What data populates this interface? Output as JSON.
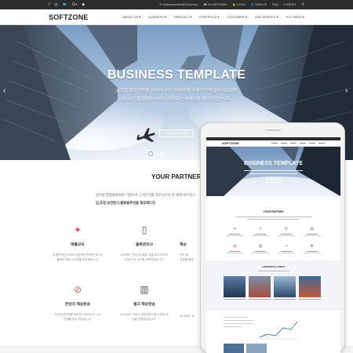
{
  "topbar": {
    "socials": [
      "f",
      "◎",
      "🐦",
      "G+",
      "▶"
    ],
    "email": "✉ Softzonecenter@Gmail.com",
    "phone": "☎ 010-5879-5899",
    "login": "🔒 LOGIN",
    "signup": "👤 SIGN UP",
    "faq": "FAQ",
    "language": "▾ 다중언어",
    "search_icon": "search-icon"
  },
  "header": {
    "logo": "SOFTZONE",
    "nav": [
      "ABOUT US ▾",
      "BUSINESS ▾",
      "PRODUCT ▾",
      "PORTFOLIO ▾",
      "CUSTOMER ▾",
      "GNU SERVICE ▾",
      "ETC MENU ▾"
    ]
  },
  "hero": {
    "title": "BUSINESS TEMPLATE",
    "line1": "글로벌 물류혁명을 위해서 가장 규제혁에, 국제가구역 물류기준설명",
    "line2": "OCC인 통합물류 서비스 경영하는 서비스을 제공하겠습니다.",
    "button": "VIEW PARTNERS",
    "prev": "‹",
    "next": "›"
  },
  "partner": {
    "title": "YOUR PARTNER",
    "line1": "글로벌 통합물류회원 기업으로 고객가치를 최우선으로 한 세계 네트워크",
    "line2": "입,포장,보관등의 물류솔루션을 제공해드리"
  },
  "features": [
    {
      "icon": "magic-wand-icon",
      "glyph": "✦",
      "title": "매출규모",
      "desc1": "우중력 예산 100% 성장하여 판매는 매 1조",
      "desc2": "플레이 목표가 성과를 달성했습니다."
    },
    {
      "icon": "smartphone-icon",
      "glyph": "▯",
      "title": "물류관리사",
      "desc1": "200명의 관리사로 물류 유통 분석 최고의",
      "desc2": "전망인 이 시스템 구축하였습니다."
    },
    {
      "icon": "link-icon",
      "glyph": "⊘",
      "title": "완성차 해상운송",
      "desc1": "안전한 운영계통 확보한 자동차사는 100",
      "desc2": "안재를 운송 하였습니다."
    },
    {
      "icon": "bar-chart-icon",
      "glyph": "▥",
      "title": "벌크 해상운송",
      "desc1": "2016년도 기준 5,000만톤의 벌크 해상 운",
      "desc2": "송을 진행하였습니다."
    }
  ],
  "partial_features": [
    {
      "title": "해상",
      "desc1": "안도,해",
      "desc2": "성과를 달성"
    },
    {
      "title": "해상",
      "desc1": "2016년도 성",
      "desc2": ""
    }
  ],
  "tablet": {
    "logo": "SOFTZONE",
    "hero_title": "BUSINESS TEMPLATE",
    "partner_title": "YOUR PARTNER",
    "logistics_title": "LOGISTICS LATEST"
  },
  "colors": {
    "accent": "#e35a4f",
    "topbar": "#2c2c2c",
    "sky_top": "#7a9cc4",
    "sky_bottom": "#d9e4ef"
  }
}
